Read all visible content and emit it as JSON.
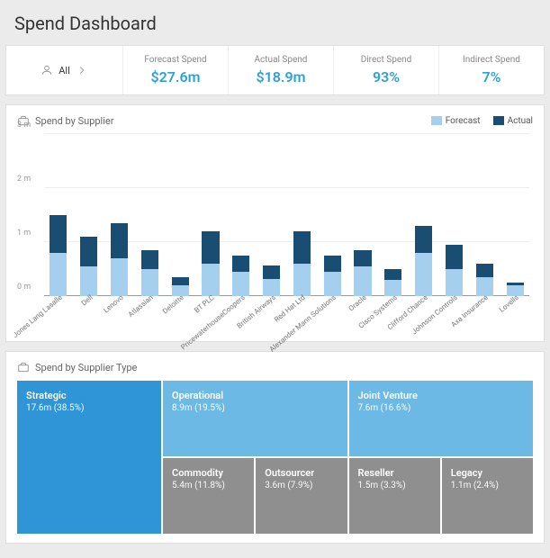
{
  "title": "Spend Dashboard",
  "filter": {
    "label": "All"
  },
  "kpis": [
    {
      "label": "Forecast Spend",
      "value": "$27.6m"
    },
    {
      "label": "Actual Spend",
      "value": "$18.9m"
    },
    {
      "label": "Direct Spend",
      "value": "93%"
    },
    {
      "label": "Indirect Spend",
      "value": "7%"
    }
  ],
  "supplier_panel": {
    "title": "Spend by Supplier"
  },
  "legend": {
    "forecast": "Forecast",
    "actual": "Actual"
  },
  "type_panel": {
    "title": "Spend by Supplier Type"
  },
  "treemap": {
    "strategic": {
      "name": "Strategic",
      "value": "17.6m (38.5%)"
    },
    "operational": {
      "name": "Operational",
      "value": "8.9m (19.5%)"
    },
    "joint": {
      "name": "Joint Venture",
      "value": "7.6m (16.6%)"
    },
    "commodity": {
      "name": "Commodity",
      "value": "5.4m (11.8%)"
    },
    "outsourcer": {
      "name": "Outsourcer",
      "value": "3.6m (7.9%)"
    },
    "reseller": {
      "name": "Reseller",
      "value": "1.5m (3.3%)"
    },
    "legacy": {
      "name": "Legacy",
      "value": "1.1m (2.4%)"
    }
  },
  "chart_data": {
    "type": "bar",
    "title": "Spend by Supplier",
    "ylabel": "",
    "xlabel": "",
    "ylim": [
      0,
      3
    ],
    "y_ticks": [
      "0 m",
      "1 m",
      "2 m",
      "3 m"
    ],
    "categories": [
      "Jones Lang Lasalle",
      "Dell",
      "Lenovo",
      "Atlassian",
      "Deloitte",
      "BT PLC",
      "PricewaterhouseCoopers",
      "British Airways",
      "Red Hat Ltd",
      "Alexander Mann Solutions",
      "Oracle",
      "Cisco Systems",
      "Clifford Chance",
      "Johnson Controls",
      "Axa Insurance",
      "Lovells"
    ],
    "series": [
      {
        "name": "Forecast",
        "color": "#a4cfee",
        "values": [
          0.8,
          0.55,
          0.7,
          0.5,
          0.2,
          0.6,
          0.45,
          0.32,
          0.6,
          0.45,
          0.55,
          0.3,
          0.8,
          0.5,
          0.35,
          0.2
        ]
      },
      {
        "name": "Actual",
        "color": "#1a4d72",
        "values": [
          0.7,
          0.55,
          0.65,
          0.35,
          0.15,
          0.6,
          0.3,
          0.25,
          0.6,
          0.3,
          0.3,
          0.2,
          0.5,
          0.45,
          0.25,
          0.05
        ]
      }
    ]
  }
}
